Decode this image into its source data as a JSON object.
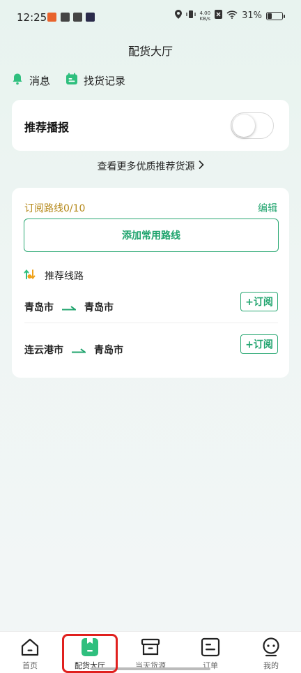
{
  "status": {
    "time": "12:25",
    "speed": "4.00\nKB/s",
    "battery": "31%",
    "battery_level": 0.31
  },
  "header": {
    "title": "配货大厅"
  },
  "quick_links": [
    {
      "label": "消息",
      "icon": "bell-icon"
    },
    {
      "label": "找货记录",
      "icon": "record-icon"
    }
  ],
  "broadcast": {
    "label": "推荐播报",
    "enabled": false
  },
  "more_link": {
    "label": "查看更多优质推荐货源"
  },
  "subscription": {
    "title": "订阅路线0/10",
    "edit_label": "编辑",
    "add_label": "添加常用路线",
    "recommend_title": "推荐线路",
    "routes": [
      {
        "from": "青岛市",
        "to": "青岛市",
        "button": "+订阅"
      },
      {
        "from": "连云港市",
        "to": "青岛市",
        "button": "+订阅"
      }
    ]
  },
  "tabs": [
    {
      "label": "首页",
      "icon": "home-icon"
    },
    {
      "label": "配货大厅",
      "icon": "cargo-hall-icon"
    },
    {
      "label": "当天货源",
      "icon": "box-icon"
    },
    {
      "label": "订单",
      "icon": "order-icon"
    },
    {
      "label": "我的",
      "icon": "profile-icon"
    }
  ],
  "colors": {
    "accent": "#20a46e",
    "gold": "#b68a1c",
    "highlight": "#e0201e"
  }
}
